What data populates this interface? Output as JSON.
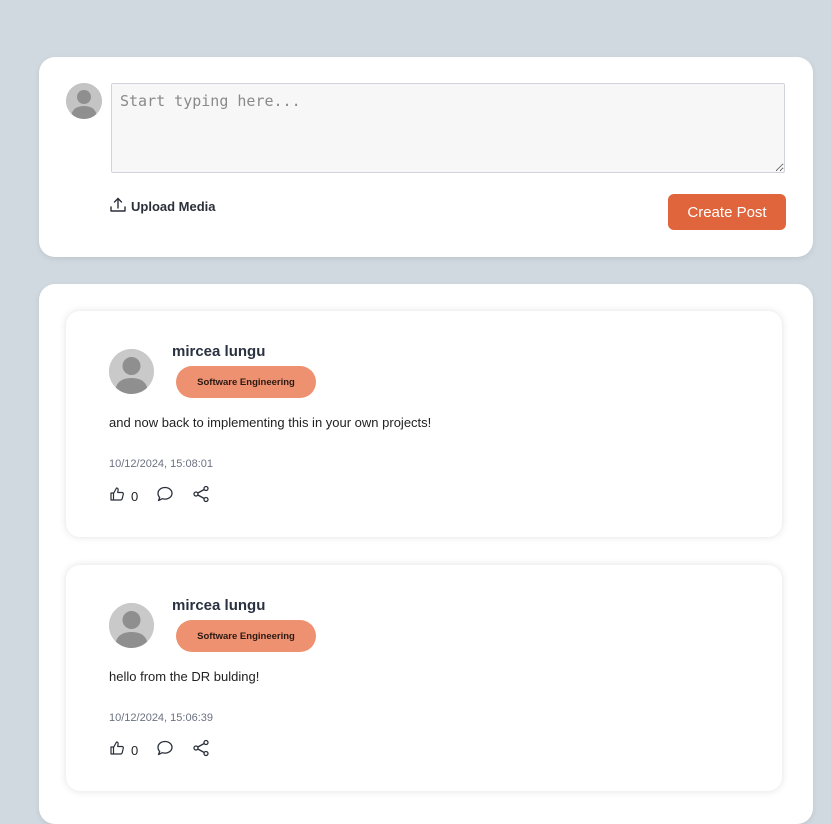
{
  "composer": {
    "placeholder": "Start typing here...",
    "upload_label": "Upload Media",
    "create_label": "Create Post"
  },
  "posts": [
    {
      "author": "mircea lungu",
      "tag": "Software Engineering",
      "content": "and now back to implementing this in your own projects!",
      "timestamp": "10/12/2024, 15:08:01",
      "likes": "0"
    },
    {
      "author": "mircea lungu",
      "tag": "Software Engineering",
      "content": "hello from the DR bulding!",
      "timestamp": "10/12/2024, 15:06:39",
      "likes": "0"
    }
  ],
  "colors": {
    "background": "#cfd9df",
    "accent": "#e0643c",
    "tag": "#ee9170"
  },
  "icons": [
    "user-avatar-icon",
    "upload-icon",
    "thumbs-up-icon",
    "comment-icon",
    "share-icon"
  ]
}
